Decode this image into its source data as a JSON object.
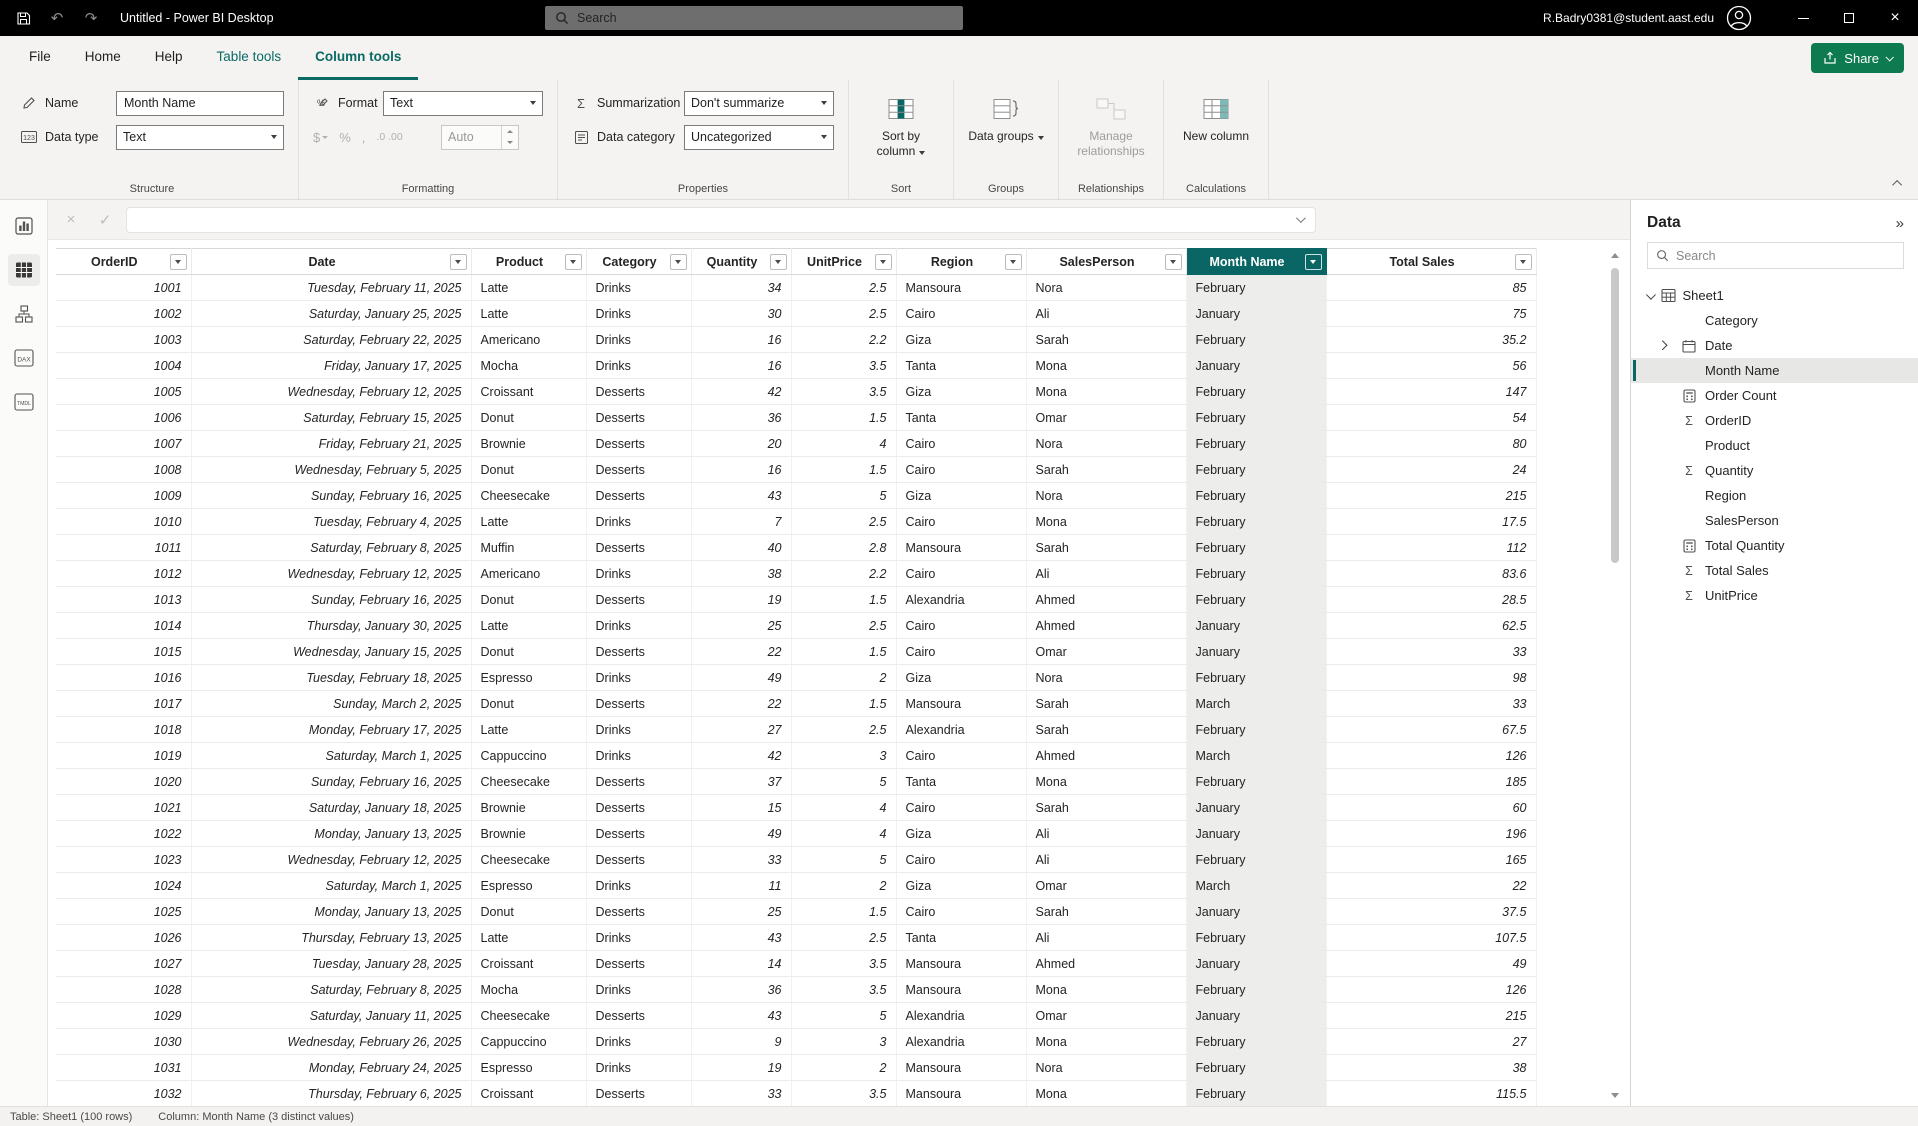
{
  "titlebar": {
    "title": "Untitled - Power BI Desktop",
    "search_placeholder": "Search",
    "user_email": "R.Badry0381@student.aast.edu"
  },
  "menu": {
    "tabs": [
      {
        "label": "File",
        "contextual": false,
        "active": false
      },
      {
        "label": "Home",
        "contextual": false,
        "active": false
      },
      {
        "label": "Help",
        "contextual": false,
        "active": false
      },
      {
        "label": "Table tools",
        "contextual": true,
        "active": false
      },
      {
        "label": "Column tools",
        "contextual": true,
        "active": true
      }
    ],
    "share_label": "Share"
  },
  "ribbon": {
    "structure": {
      "group_label": "Structure",
      "name_label": "Name",
      "name_value": "Month Name",
      "datatype_label": "Data type",
      "datatype_value": "Text"
    },
    "formatting": {
      "group_label": "Formatting",
      "format_label": "Format",
      "format_value": "Text",
      "auto_value": "Auto"
    },
    "properties": {
      "group_label": "Properties",
      "summarization_label": "Summarization",
      "summarization_value": "Don't summarize",
      "datacategory_label": "Data category",
      "datacategory_value": "Uncategorized"
    },
    "sort": {
      "group_label": "Sort",
      "button_label": "Sort by column"
    },
    "groups": {
      "group_label": "Groups",
      "button_label": "Data groups"
    },
    "relationships": {
      "group_label": "Relationships",
      "button_label": "Manage relationships"
    },
    "calculations": {
      "group_label": "Calculations",
      "button_label": "New column"
    }
  },
  "table": {
    "selected_column": "Month Name",
    "columns": [
      "OrderID",
      "Date",
      "Product",
      "Category",
      "Quantity",
      "UnitPrice",
      "Region",
      "SalesPerson",
      "Month Name",
      "Total Sales"
    ],
    "rows": [
      [
        "1001",
        "Tuesday, February 11, 2025",
        "Latte",
        "Drinks",
        "34",
        "2.5",
        "Mansoura",
        "Nora",
        "February",
        "85"
      ],
      [
        "1002",
        "Saturday, January 25, 2025",
        "Latte",
        "Drinks",
        "30",
        "2.5",
        "Cairo",
        "Ali",
        "January",
        "75"
      ],
      [
        "1003",
        "Saturday, February 22, 2025",
        "Americano",
        "Drinks",
        "16",
        "2.2",
        "Giza",
        "Sarah",
        "February",
        "35.2"
      ],
      [
        "1004",
        "Friday, January 17, 2025",
        "Mocha",
        "Drinks",
        "16",
        "3.5",
        "Tanta",
        "Mona",
        "January",
        "56"
      ],
      [
        "1005",
        "Wednesday, February 12, 2025",
        "Croissant",
        "Desserts",
        "42",
        "3.5",
        "Giza",
        "Mona",
        "February",
        "147"
      ],
      [
        "1006",
        "Saturday, February 15, 2025",
        "Donut",
        "Desserts",
        "36",
        "1.5",
        "Tanta",
        "Omar",
        "February",
        "54"
      ],
      [
        "1007",
        "Friday, February 21, 2025",
        "Brownie",
        "Desserts",
        "20",
        "4",
        "Cairo",
        "Nora",
        "February",
        "80"
      ],
      [
        "1008",
        "Wednesday, February 5, 2025",
        "Donut",
        "Desserts",
        "16",
        "1.5",
        "Cairo",
        "Sarah",
        "February",
        "24"
      ],
      [
        "1009",
        "Sunday, February 16, 2025",
        "Cheesecake",
        "Desserts",
        "43",
        "5",
        "Giza",
        "Nora",
        "February",
        "215"
      ],
      [
        "1010",
        "Tuesday, February 4, 2025",
        "Latte",
        "Drinks",
        "7",
        "2.5",
        "Cairo",
        "Mona",
        "February",
        "17.5"
      ],
      [
        "1011",
        "Saturday, February 8, 2025",
        "Muffin",
        "Desserts",
        "40",
        "2.8",
        "Mansoura",
        "Sarah",
        "February",
        "112"
      ],
      [
        "1012",
        "Wednesday, February 12, 2025",
        "Americano",
        "Drinks",
        "38",
        "2.2",
        "Cairo",
        "Ali",
        "February",
        "83.6"
      ],
      [
        "1013",
        "Sunday, February 16, 2025",
        "Donut",
        "Desserts",
        "19",
        "1.5",
        "Alexandria",
        "Ahmed",
        "February",
        "28.5"
      ],
      [
        "1014",
        "Thursday, January 30, 2025",
        "Latte",
        "Drinks",
        "25",
        "2.5",
        "Cairo",
        "Ahmed",
        "January",
        "62.5"
      ],
      [
        "1015",
        "Wednesday, January 15, 2025",
        "Donut",
        "Desserts",
        "22",
        "1.5",
        "Cairo",
        "Omar",
        "January",
        "33"
      ],
      [
        "1016",
        "Tuesday, February 18, 2025",
        "Espresso",
        "Drinks",
        "49",
        "2",
        "Giza",
        "Nora",
        "February",
        "98"
      ],
      [
        "1017",
        "Sunday, March 2, 2025",
        "Donut",
        "Desserts",
        "22",
        "1.5",
        "Mansoura",
        "Sarah",
        "March",
        "33"
      ],
      [
        "1018",
        "Monday, February 17, 2025",
        "Latte",
        "Drinks",
        "27",
        "2.5",
        "Alexandria",
        "Sarah",
        "February",
        "67.5"
      ],
      [
        "1019",
        "Saturday, March 1, 2025",
        "Cappuccino",
        "Drinks",
        "42",
        "3",
        "Cairo",
        "Ahmed",
        "March",
        "126"
      ],
      [
        "1020",
        "Sunday, February 16, 2025",
        "Cheesecake",
        "Desserts",
        "37",
        "5",
        "Tanta",
        "Mona",
        "February",
        "185"
      ],
      [
        "1021",
        "Saturday, January 18, 2025",
        "Brownie",
        "Desserts",
        "15",
        "4",
        "Cairo",
        "Sarah",
        "January",
        "60"
      ],
      [
        "1022",
        "Monday, January 13, 2025",
        "Brownie",
        "Desserts",
        "49",
        "4",
        "Giza",
        "Ali",
        "January",
        "196"
      ],
      [
        "1023",
        "Wednesday, February 12, 2025",
        "Cheesecake",
        "Desserts",
        "33",
        "5",
        "Cairo",
        "Ali",
        "February",
        "165"
      ],
      [
        "1024",
        "Saturday, March 1, 2025",
        "Espresso",
        "Drinks",
        "11",
        "2",
        "Giza",
        "Omar",
        "March",
        "22"
      ],
      [
        "1025",
        "Monday, January 13, 2025",
        "Donut",
        "Desserts",
        "25",
        "1.5",
        "Cairo",
        "Sarah",
        "January",
        "37.5"
      ],
      [
        "1026",
        "Thursday, February 13, 2025",
        "Latte",
        "Drinks",
        "43",
        "2.5",
        "Tanta",
        "Ali",
        "February",
        "107.5"
      ],
      [
        "1027",
        "Tuesday, January 28, 2025",
        "Croissant",
        "Desserts",
        "14",
        "3.5",
        "Mansoura",
        "Ahmed",
        "January",
        "49"
      ],
      [
        "1028",
        "Saturday, February 8, 2025",
        "Mocha",
        "Drinks",
        "36",
        "3.5",
        "Mansoura",
        "Mona",
        "February",
        "126"
      ],
      [
        "1029",
        "Saturday, January 11, 2025",
        "Cheesecake",
        "Desserts",
        "43",
        "5",
        "Alexandria",
        "Omar",
        "January",
        "215"
      ],
      [
        "1030",
        "Wednesday, February 26, 2025",
        "Cappuccino",
        "Drinks",
        "9",
        "3",
        "Alexandria",
        "Mona",
        "February",
        "27"
      ],
      [
        "1031",
        "Monday, February 24, 2025",
        "Espresso",
        "Drinks",
        "19",
        "2",
        "Mansoura",
        "Nora",
        "February",
        "38"
      ],
      [
        "1032",
        "Thursday, February 6, 2025",
        "Croissant",
        "Desserts",
        "33",
        "3.5",
        "Mansoura",
        "Mona",
        "February",
        "115.5"
      ]
    ]
  },
  "data_pane": {
    "title": "Data",
    "search_placeholder": "Search",
    "table_name": "Sheet1",
    "fields": [
      {
        "name": "Category",
        "icon": "none",
        "expandable": false,
        "selected": false
      },
      {
        "name": "Date",
        "icon": "calendar",
        "expandable": true,
        "selected": false
      },
      {
        "name": "Month Name",
        "icon": "none",
        "expandable": false,
        "selected": true
      },
      {
        "name": "Order Count",
        "icon": "measure",
        "expandable": false,
        "selected": false
      },
      {
        "name": "OrderID",
        "icon": "sigma",
        "expandable": false,
        "selected": false
      },
      {
        "name": "Product",
        "icon": "none",
        "expandable": false,
        "selected": false
      },
      {
        "name": "Quantity",
        "icon": "sigma",
        "expandable": false,
        "selected": false
      },
      {
        "name": "Region",
        "icon": "none",
        "expandable": false,
        "selected": false
      },
      {
        "name": "SalesPerson",
        "icon": "none",
        "expandable": false,
        "selected": false
      },
      {
        "name": "Total Quantity",
        "icon": "measure",
        "expandable": false,
        "selected": false
      },
      {
        "name": "Total Sales",
        "icon": "sigma",
        "expandable": false,
        "selected": false
      },
      {
        "name": "UnitPrice",
        "icon": "sigma",
        "expandable": false,
        "selected": false
      }
    ]
  },
  "status_bar": {
    "table_info": "Table: Sheet1 (100 rows)",
    "column_info": "Column: Month Name (3 distinct values)"
  },
  "colors": {
    "accent_teal": "#0a6664",
    "share_green": "#0d7a4f",
    "titlebar_black": "#000000"
  }
}
